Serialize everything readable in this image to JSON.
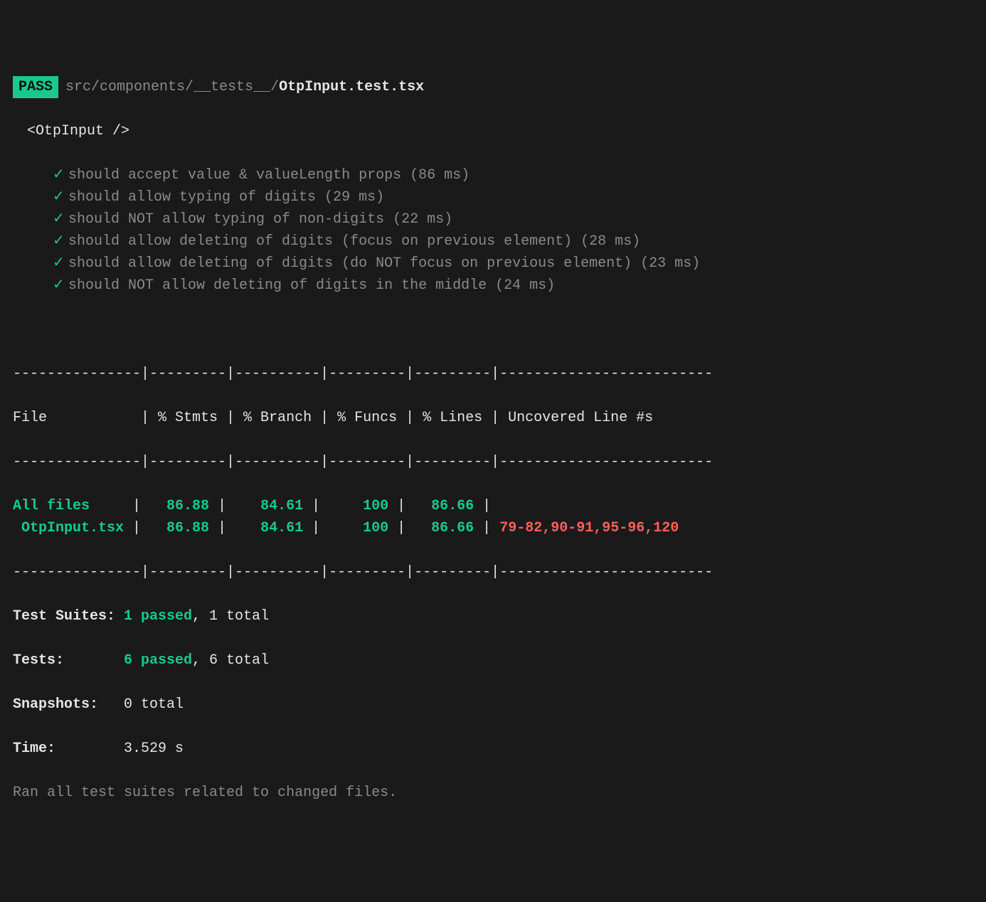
{
  "pass_badge": "PASS",
  "file_path_dim": "src/components/__tests__/",
  "file_name_bold": "OtpInput.test.tsx",
  "suite_name": "<OtpInput />",
  "tests": [
    {
      "check": "✓",
      "desc": "should accept value & valueLength props (86 ms)"
    },
    {
      "check": "✓",
      "desc": "should allow typing of digits (29 ms)"
    },
    {
      "check": "✓",
      "desc": "should NOT allow typing of non-digits (22 ms)"
    },
    {
      "check": "✓",
      "desc": "should allow deleting of digits (focus on previous element) (28 ms)"
    },
    {
      "check": "✓",
      "desc": "should allow deleting of digits (do NOT focus on previous element) (23 ms)"
    },
    {
      "check": "✓",
      "desc": "should NOT allow deleting of digits in the middle (24 ms)"
    }
  ],
  "table_sep_top": "---------------|---------|----------|---------|---------|-------------------------",
  "table_header": "File           | % Stmts | % Branch | % Funcs | % Lines | Uncovered Line #s       ",
  "table_sep_header": "---------------|---------|----------|---------|---------|-------------------------",
  "coverage_rows": [
    {
      "file": "All files     ",
      "stmts": "  86.88",
      "branch": "   84.61",
      "funcs": "    100",
      "lines": "  86.66",
      "uncov": "",
      "uncov_class": ""
    },
    {
      "file": " OtpInput.tsx ",
      "stmts": "  86.88",
      "branch": "   84.61",
      "funcs": "    100",
      "lines": "  86.66",
      "uncov": "79-82,90-91,95-96,120",
      "uncov_class": "red"
    }
  ],
  "table_sep_bottom": "---------------|---------|----------|---------|---------|-------------------------",
  "summary": {
    "suites_label": "Test Suites:",
    "suites_pass": "1 passed",
    "suites_total": ", 1 total",
    "tests_label": "Tests:",
    "tests_pass": "6 passed",
    "tests_total": ", 6 total",
    "snapshots_label": "Snapshots:",
    "snapshots_value": "0 total",
    "time_label": "Time:",
    "time_value": "3.529 s",
    "footer": "Ran all test suites related to changed files."
  }
}
